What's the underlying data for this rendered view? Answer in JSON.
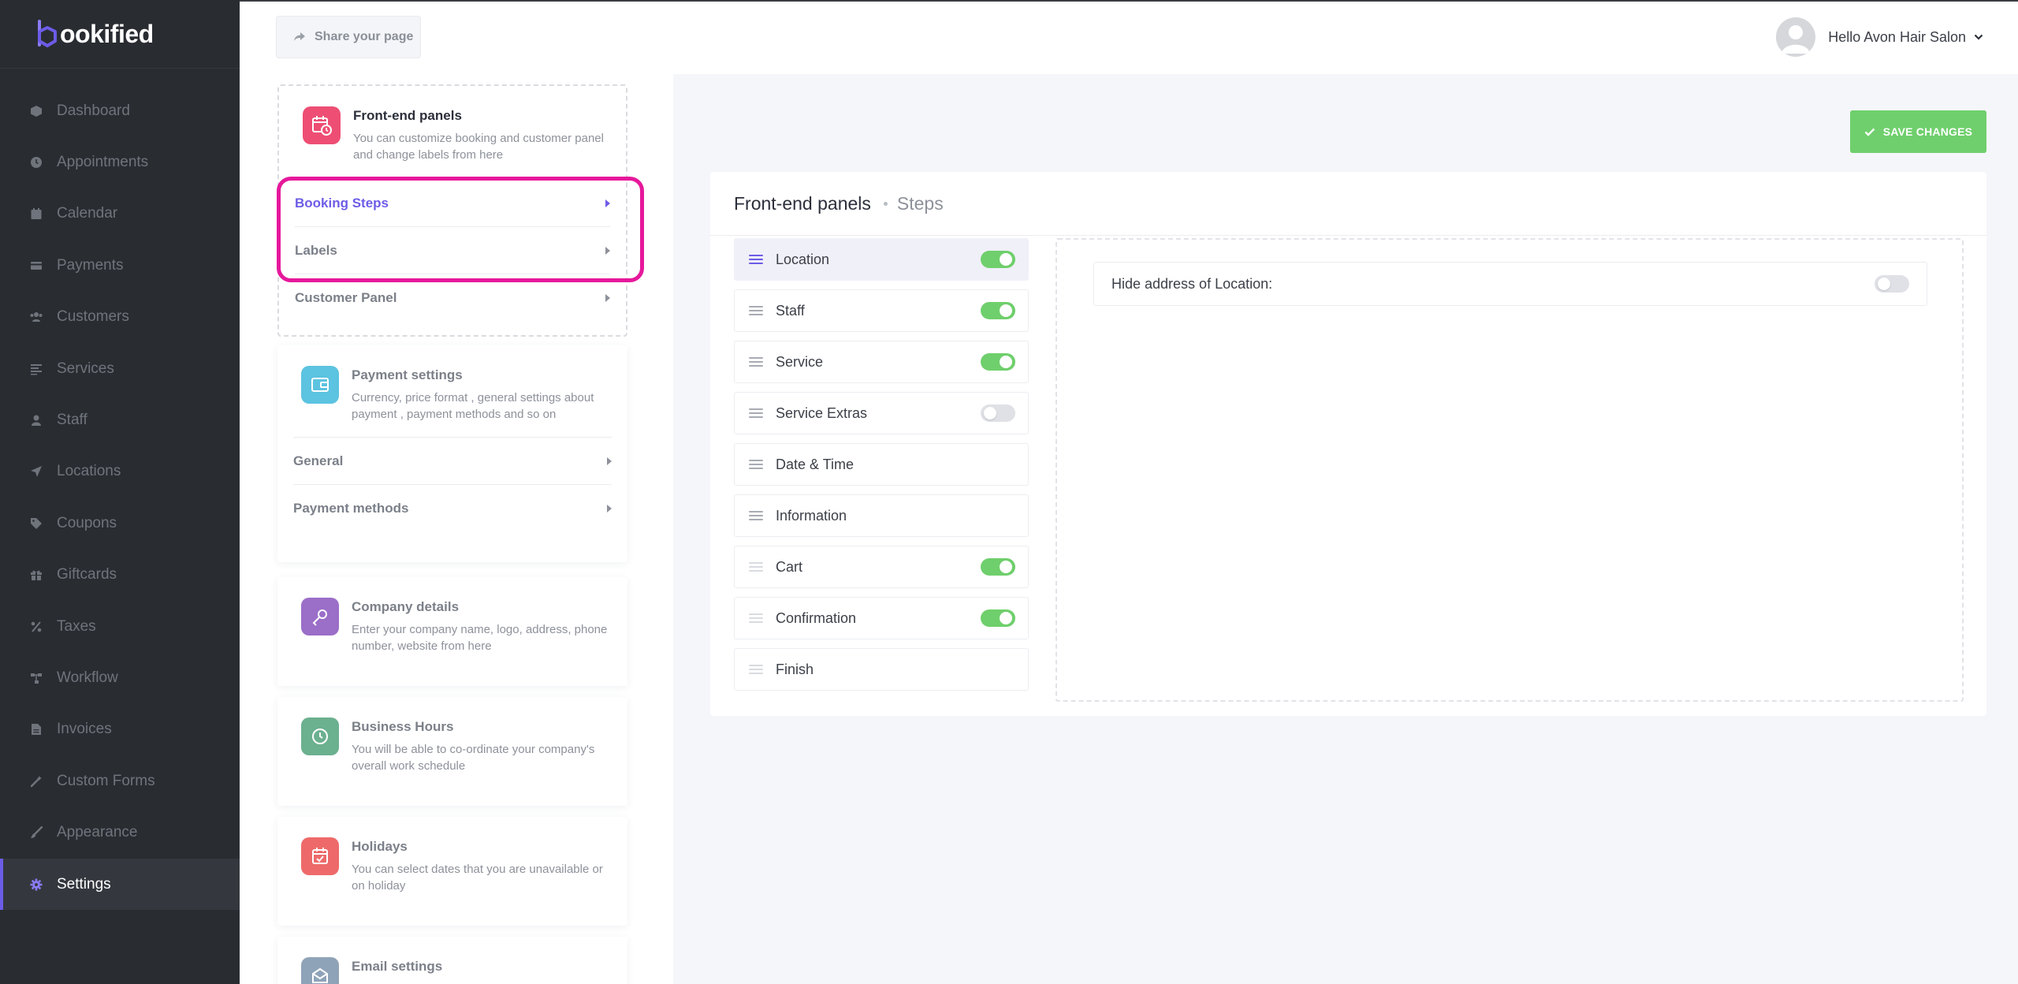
{
  "app": {
    "logo_text": "ookified",
    "brand_color": "#6c5ce7"
  },
  "sidebar": {
    "items": [
      {
        "label": "Dashboard",
        "icon": "cube-icon"
      },
      {
        "label": "Appointments",
        "icon": "clock-icon"
      },
      {
        "label": "Calendar",
        "icon": "calendar-icon"
      },
      {
        "label": "Payments",
        "icon": "credit-card-icon"
      },
      {
        "label": "Customers",
        "icon": "users-icon"
      },
      {
        "label": "Services",
        "icon": "list-icon"
      },
      {
        "label": "Staff",
        "icon": "user-icon"
      },
      {
        "label": "Locations",
        "icon": "location-arrow-icon"
      },
      {
        "label": "Coupons",
        "icon": "tag-icon"
      },
      {
        "label": "Giftcards",
        "icon": "gift-icon"
      },
      {
        "label": "Taxes",
        "icon": "percent-icon"
      },
      {
        "label": "Workflow",
        "icon": "workflow-icon"
      },
      {
        "label": "Invoices",
        "icon": "invoice-icon"
      },
      {
        "label": "Custom Forms",
        "icon": "magic-wand-icon"
      },
      {
        "label": "Appearance",
        "icon": "brush-icon"
      },
      {
        "label": "Settings",
        "icon": "gear-icon",
        "active": true
      }
    ]
  },
  "topbar": {
    "share_label": "Share your page",
    "user_greeting": "Hello Avon Hair Salon"
  },
  "settings_cards": {
    "frontend": {
      "title": "Front-end panels",
      "desc": "You can customize booking and customer panel and change labels from here",
      "items": [
        "Booking Steps",
        "Labels",
        "Customer Panel"
      ]
    },
    "payment": {
      "title": "Payment settings",
      "desc": "Currency, price format , general settings about payment , payment methods and so on",
      "items": [
        "General",
        "Payment methods"
      ]
    },
    "company": {
      "title": "Company details",
      "desc": "Enter your company name, logo, address, phone number, website from here"
    },
    "hours": {
      "title": "Business Hours",
      "desc": "You will be able to co-ordinate your company's overall work schedule"
    },
    "holidays": {
      "title": "Holidays",
      "desc": "You can select dates that you are unavailable or on holiday"
    },
    "email": {
      "title": "Email settings"
    }
  },
  "main": {
    "save_label": "SAVE CHANGES",
    "panel_title": "Front-end panels",
    "panel_subtitle": "Steps",
    "steps": [
      {
        "label": "Location",
        "toggle": "on",
        "active": true
      },
      {
        "label": "Staff",
        "toggle": "on"
      },
      {
        "label": "Service",
        "toggle": "on"
      },
      {
        "label": "Service Extras",
        "toggle": "off"
      },
      {
        "label": "Date & Time",
        "toggle": null
      },
      {
        "label": "Information",
        "toggle": null
      },
      {
        "label": "Cart",
        "toggle": "on",
        "locked": true
      },
      {
        "label": "Confirmation",
        "toggle": "on",
        "locked": true
      },
      {
        "label": "Finish",
        "toggle": null,
        "locked": true
      }
    ],
    "option_label": "Hide address of Location:",
    "option_value": "off"
  }
}
